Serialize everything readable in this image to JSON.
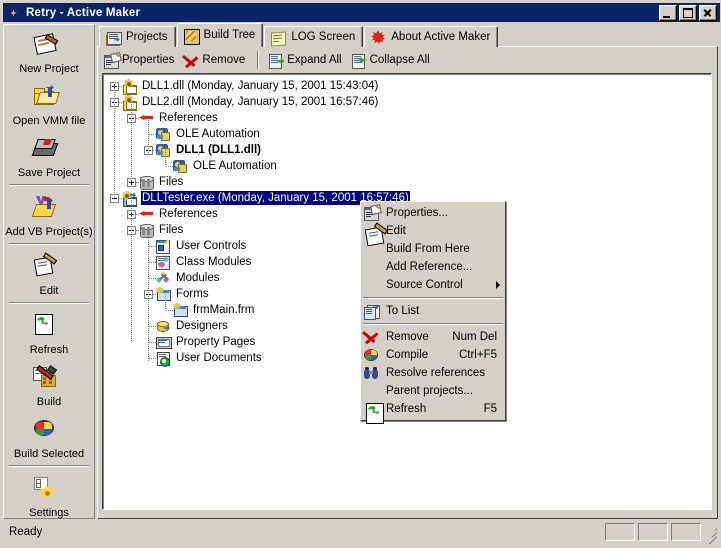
{
  "window": {
    "title": "Retry - Active Maker",
    "icon": "star-icon",
    "minimize_label": "Minimize",
    "maximize_label": "Maximize",
    "close_label": "Close"
  },
  "sidebar": {
    "items": [
      {
        "label": "New Project",
        "icon": "new-project-icon",
        "separator_after": false
      },
      {
        "label": "Open VMM file",
        "icon": "open-folder-icon",
        "separator_after": false
      },
      {
        "label": "Save Project",
        "icon": "save-disk-icon",
        "separator_after": true
      },
      {
        "label": "Add VB Project(s)",
        "icon": "add-vb-icon",
        "separator_after": true
      },
      {
        "label": "Edit",
        "icon": "edit-pencil-icon",
        "separator_after": true
      },
      {
        "label": "Refresh",
        "icon": "refresh-icon",
        "separator_after": false
      },
      {
        "label": "Build",
        "icon": "build-hammer-icon",
        "separator_after": false
      },
      {
        "label": "Build Selected",
        "icon": "build-selected-icon",
        "separator_after": true
      },
      {
        "label": "Settings",
        "icon": "settings-gear-icon",
        "separator_after": false
      }
    ]
  },
  "tabs": [
    {
      "label": "Projects",
      "icon": "projects-icon",
      "active": false
    },
    {
      "label": "Build Tree",
      "icon": "build-tree-icon",
      "active": true
    },
    {
      "label": "LOG Screen",
      "icon": "log-screen-icon",
      "active": false
    },
    {
      "label": "About Active Maker",
      "icon": "about-icon",
      "active": false
    }
  ],
  "toolbar": {
    "buttons": [
      {
        "label": "Properties",
        "icon": "properties-icon",
        "sep_after": false
      },
      {
        "label": "Remove",
        "icon": "remove-x-icon",
        "sep_after": true
      },
      {
        "label": "Expand All",
        "icon": "expand-all-icon",
        "sep_after": false
      },
      {
        "label": "Collapse All",
        "icon": "collapse-all-icon",
        "sep_after": false
      }
    ]
  },
  "tree": {
    "nodes": [
      {
        "id": "n0",
        "label": "DLL1.dll (Monday, January 15, 2001 15:43:04)",
        "depth": 0,
        "icon": "dll-project-icon",
        "toggle": "plus",
        "bold": false,
        "selected": false
      },
      {
        "id": "n1",
        "label": "DLL2.dll (Monday, January 15, 2001 16:57:46)",
        "depth": 0,
        "icon": "dll-project-icon",
        "toggle": "minus",
        "bold": false,
        "selected": false
      },
      {
        "id": "n2",
        "label": "References",
        "depth": 1,
        "icon": "references-icon",
        "toggle": "minus",
        "bold": false,
        "selected": false
      },
      {
        "id": "n3",
        "label": "OLE Automation",
        "depth": 2,
        "icon": "reference-item-icon",
        "toggle": "none",
        "bold": false,
        "selected": false
      },
      {
        "id": "n4",
        "label": "DLL1 (DLL1.dll)",
        "depth": 2,
        "icon": "reference-item-icon",
        "toggle": "minus",
        "bold": true,
        "selected": false
      },
      {
        "id": "n5",
        "label": "OLE Automation",
        "depth": 3,
        "icon": "reference-item-icon",
        "toggle": "none",
        "bold": false,
        "selected": false
      },
      {
        "id": "n6",
        "label": "Files",
        "depth": 1,
        "icon": "files-icon",
        "toggle": "plus",
        "bold": false,
        "selected": false
      },
      {
        "id": "n7",
        "label": "DLLTester.exe (Monday, January 15, 2001 16:57:46)",
        "depth": 0,
        "icon": "exe-project-icon",
        "toggle": "minus",
        "bold": false,
        "selected": true
      },
      {
        "id": "n8",
        "label": "References",
        "depth": 1,
        "icon": "references-icon",
        "toggle": "plus",
        "bold": false,
        "selected": false
      },
      {
        "id": "n9",
        "label": "Files",
        "depth": 1,
        "icon": "files-icon",
        "toggle": "minus",
        "bold": false,
        "selected": false
      },
      {
        "id": "n10",
        "label": "User Controls",
        "depth": 2,
        "icon": "user-controls-icon",
        "toggle": "none",
        "bold": false,
        "selected": false
      },
      {
        "id": "n11",
        "label": "Class Modules",
        "depth": 2,
        "icon": "class-modules-icon",
        "toggle": "none",
        "bold": false,
        "selected": false
      },
      {
        "id": "n12",
        "label": "Modules",
        "depth": 2,
        "icon": "modules-icon",
        "toggle": "none",
        "bold": false,
        "selected": false
      },
      {
        "id": "n13",
        "label": "Forms",
        "depth": 2,
        "icon": "forms-icon",
        "toggle": "minus",
        "bold": false,
        "selected": false
      },
      {
        "id": "n14",
        "label": "frmMain.frm",
        "depth": 3,
        "icon": "form-file-icon",
        "toggle": "none",
        "bold": false,
        "selected": false
      },
      {
        "id": "n15",
        "label": "Designers",
        "depth": 2,
        "icon": "designers-icon",
        "toggle": "none",
        "bold": false,
        "selected": false
      },
      {
        "id": "n16",
        "label": "Property Pages",
        "depth": 2,
        "icon": "property-pages-icon",
        "toggle": "none",
        "bold": false,
        "selected": false
      },
      {
        "id": "n17",
        "label": "User Documents",
        "depth": 2,
        "icon": "user-documents-icon",
        "toggle": "none",
        "bold": false,
        "selected": false
      }
    ]
  },
  "context_menu": {
    "items": [
      {
        "type": "item",
        "label": "Properties...",
        "icon": "properties-icon",
        "accel": "",
        "submenu": false
      },
      {
        "type": "item",
        "label": "Edit",
        "icon": "edit-pencil-icon",
        "accel": "",
        "submenu": false
      },
      {
        "type": "item",
        "label": "Build From Here",
        "icon": "",
        "accel": "",
        "submenu": false
      },
      {
        "type": "item",
        "label": "Add Reference...",
        "icon": "",
        "accel": "",
        "submenu": false
      },
      {
        "type": "item",
        "label": "Source Control",
        "icon": "",
        "accel": "",
        "submenu": true
      },
      {
        "type": "separator"
      },
      {
        "type": "item",
        "label": "To List",
        "icon": "to-list-icon",
        "accel": "",
        "submenu": false
      },
      {
        "type": "separator"
      },
      {
        "type": "item",
        "label": "Remove",
        "icon": "remove-x-icon",
        "accel": "Num Del",
        "submenu": false
      },
      {
        "type": "item",
        "label": "Compile",
        "icon": "compile-icon",
        "accel": "Ctrl+F5",
        "submenu": false
      },
      {
        "type": "item",
        "label": "Resolve references",
        "icon": "binoculars-icon",
        "accel": "",
        "submenu": false
      },
      {
        "type": "item",
        "label": "Parent projects...",
        "icon": "",
        "accel": "",
        "submenu": false
      },
      {
        "type": "item",
        "label": "Refresh",
        "icon": "refresh-icon",
        "accel": "F5",
        "submenu": false
      }
    ]
  },
  "statusbar": {
    "message": "Ready",
    "panes": [
      "",
      "",
      ""
    ]
  },
  "colors": {
    "face": "#d4d0c8",
    "titlebar": "#000080",
    "selection": "#000080",
    "shadow": "#808080",
    "window": "#ffffff"
  }
}
